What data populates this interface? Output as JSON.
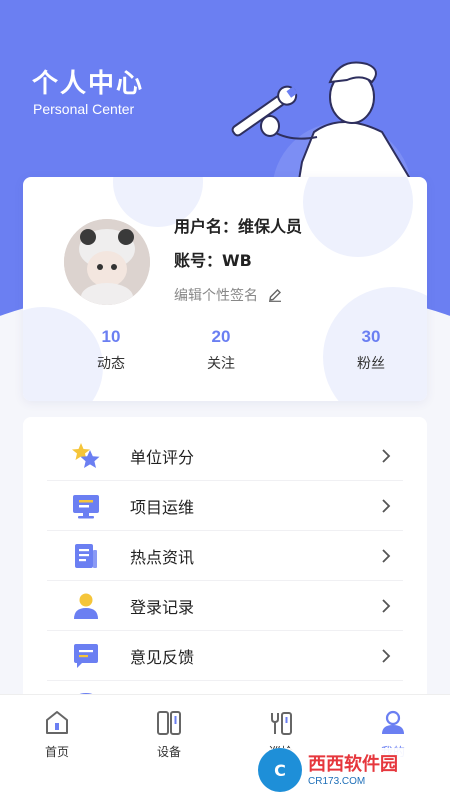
{
  "header": {
    "title": "个人中心",
    "subtitle": "Personal Center"
  },
  "profile": {
    "username_label": "用户名：维保人员",
    "account_label": "账号：WB",
    "signature_placeholder": "编辑个性签名"
  },
  "stats": [
    {
      "value": "10",
      "label": "动态"
    },
    {
      "value": "20",
      "label": "关注"
    },
    {
      "value": "30",
      "label": "粉丝"
    }
  ],
  "menu": [
    {
      "label": "单位评分",
      "icon": "star-icon"
    },
    {
      "label": "项目运维",
      "icon": "monitor-icon"
    },
    {
      "label": "热点资讯",
      "icon": "news-icon"
    },
    {
      "label": "登录记录",
      "icon": "user-icon"
    },
    {
      "label": "意见反馈",
      "icon": "message-icon"
    }
  ],
  "tabbar": [
    {
      "label": "首页",
      "icon": "home-icon",
      "active": false
    },
    {
      "label": "设备",
      "icon": "device-icon",
      "active": false
    },
    {
      "label": "巡检",
      "icon": "inspection-icon",
      "active": false
    },
    {
      "label": "我的",
      "icon": "profile-icon",
      "active": true
    }
  ],
  "watermark": {
    "badge": "C",
    "main": "西西软件园",
    "sub": "CR173.COM"
  },
  "colors": {
    "primary": "#6b7ff2",
    "accent_yellow": "#f5c53a",
    "background": "#f5f6fb"
  }
}
